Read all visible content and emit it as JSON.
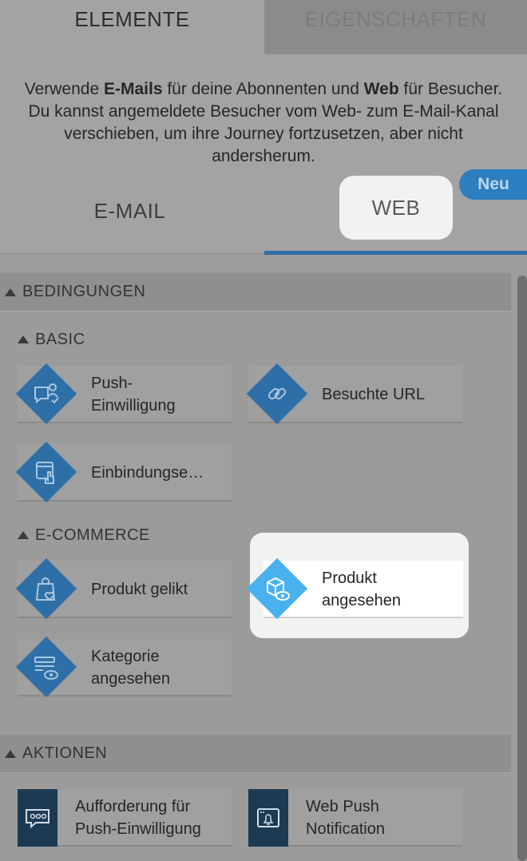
{
  "top_tabs": {
    "elements": "ELEMENTE",
    "properties": "EIGENSCHAFTEN"
  },
  "intro": {
    "part1": "Verwende ",
    "bold1": "E-Mails",
    "part2": " für deine Abonnenten und ",
    "bold2": "Web",
    "part3": " für Besucher. Du kannst angemeldete Besucher vom Web- zum E-Mail-Kanal verschieben, um ihre Journey fortzusetzen, aber nicht andersherum."
  },
  "channels": {
    "email": "E-MAIL",
    "web": "WEB",
    "new_badge": "Neu"
  },
  "sections": {
    "conditions": "BEDINGUNGEN",
    "basic": "BASIC",
    "ecommerce": "E-COMMERCE",
    "actions": "AKTIONEN"
  },
  "basic_items": {
    "push_consent": "Push-\nEinwilligung",
    "visited_url": "Besuchte URL",
    "embedding": "Einbindungse…"
  },
  "ecommerce_items": {
    "product_liked": "Produkt gelikt",
    "product_viewed": "Produkt\nangesehen",
    "category_viewed": "Kategorie\nangesehen"
  },
  "action_items": {
    "push_request": "Aufforderung für\nPush-Einwilligung",
    "web_push": "Web Push\nNotification"
  },
  "colors": {
    "accent": "#2f6fa7",
    "highlight": "#4ab1ef",
    "action_icon_bg": "#1c3a52"
  }
}
